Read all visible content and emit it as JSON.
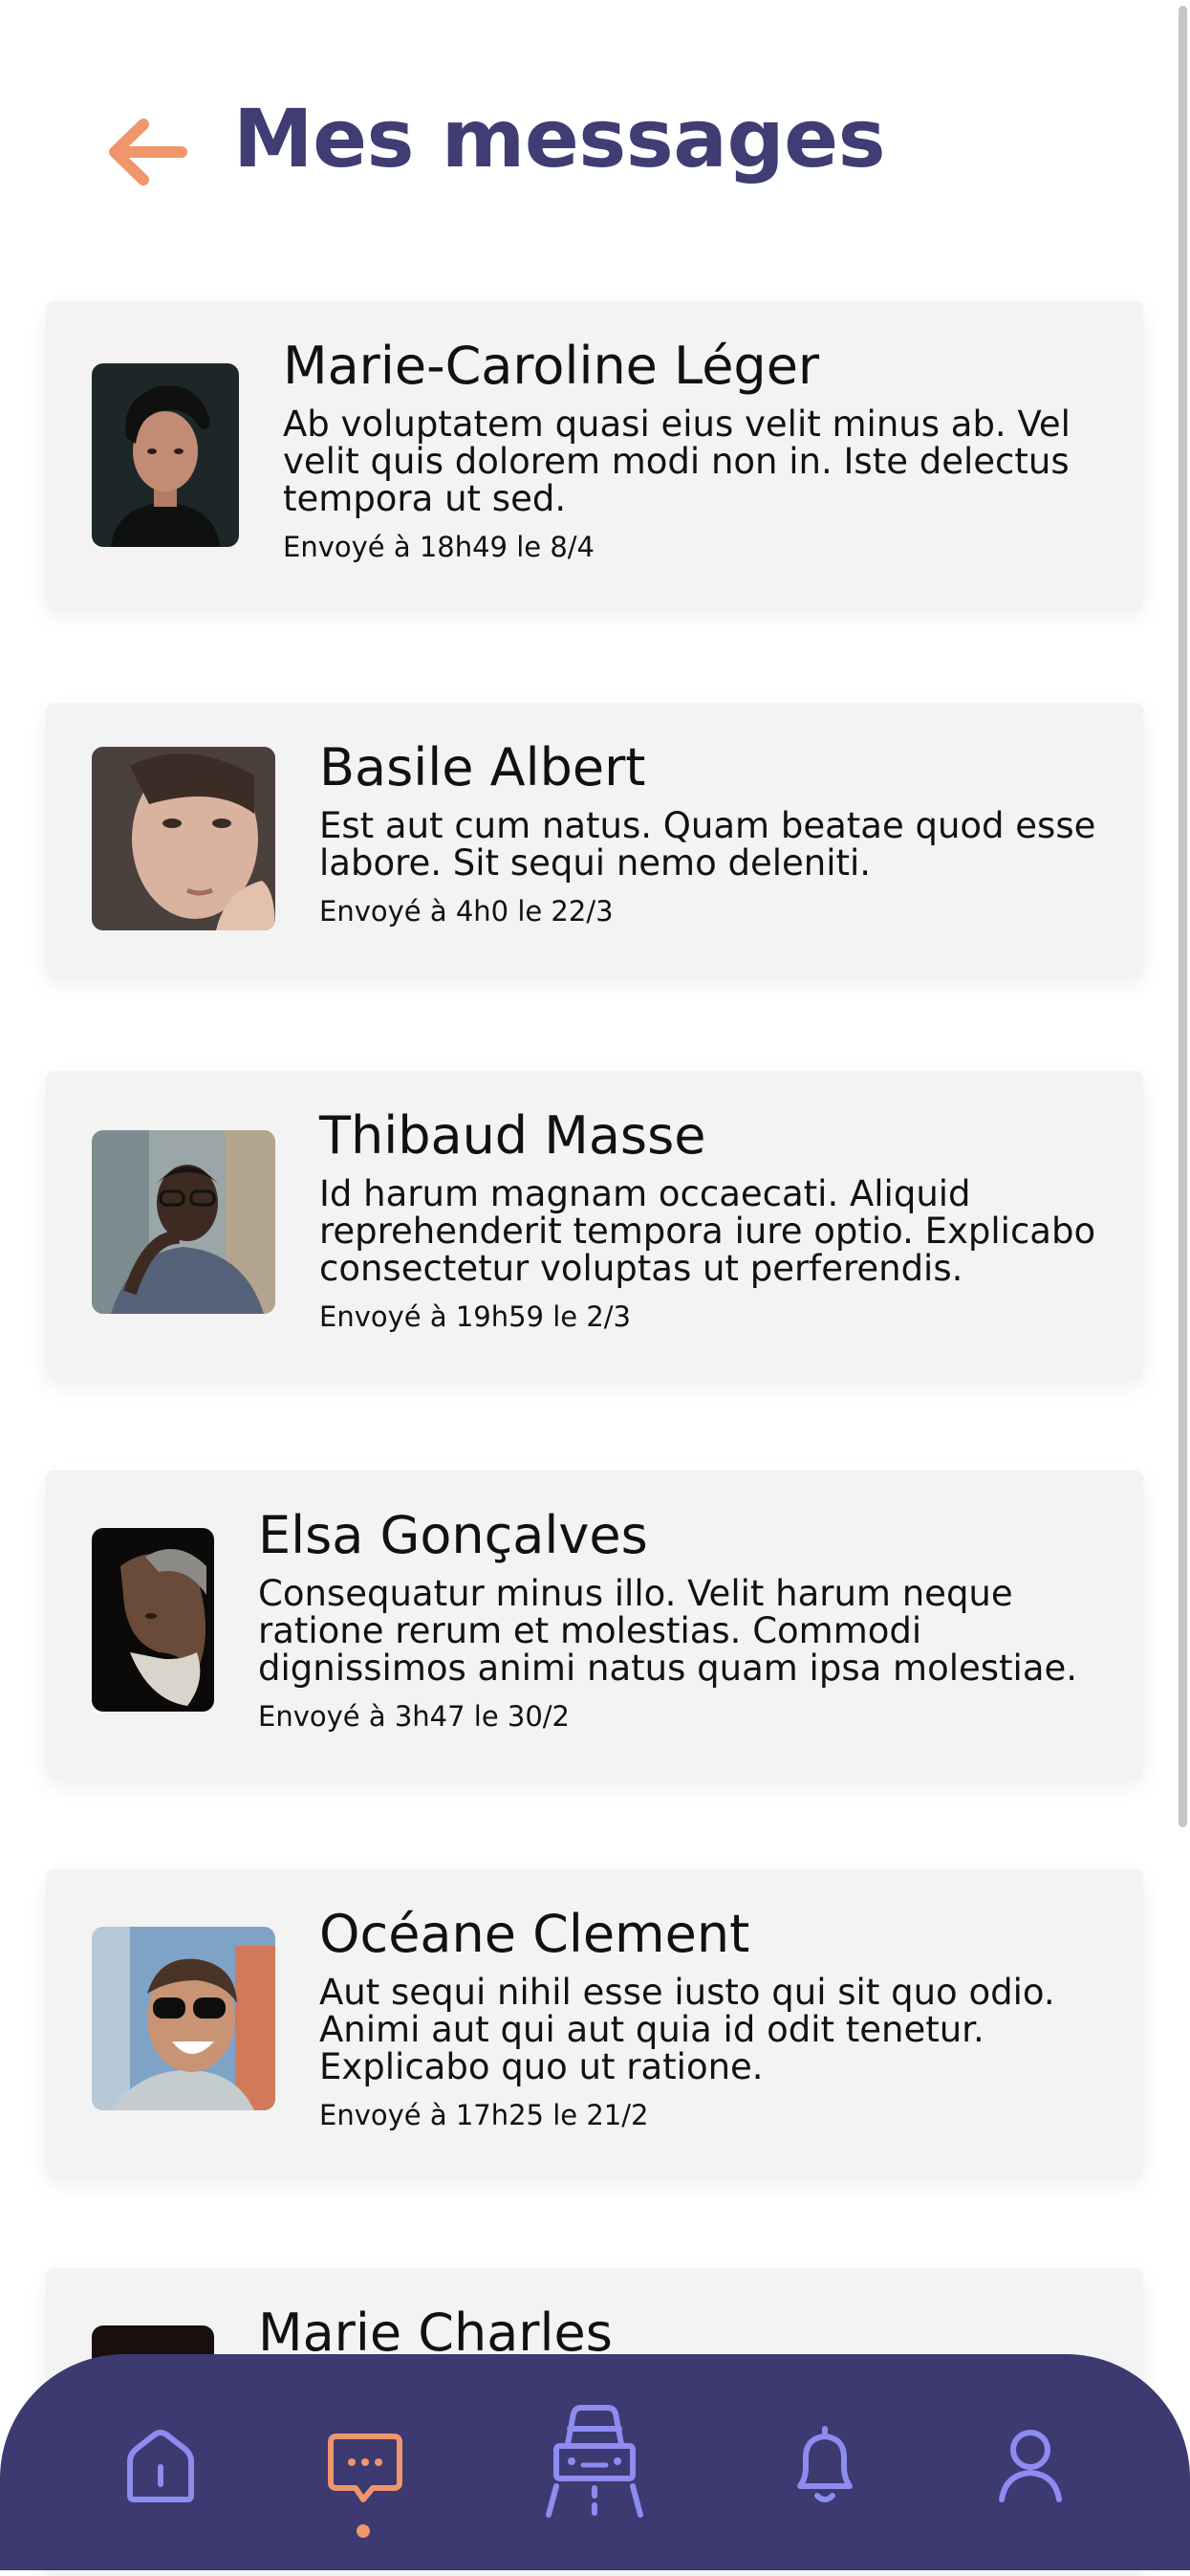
{
  "header": {
    "title": "Mes messages",
    "back_icon": "arrow-left-icon"
  },
  "colors": {
    "accent": "#f0966c",
    "primary": "#3f3d73",
    "nav_background": "#3c3a70",
    "nav_icon": "#8e8cf0",
    "card_background": "#f3f3f3"
  },
  "messages": [
    {
      "name": "Marie-Caroline Léger",
      "text": "Ab voluptatem quasi eius velit minus ab. Vel velit quis dolorem modi non in. Iste delectus tempora ut sed.",
      "time": "Envoyé à 18h49 le 8/4"
    },
    {
      "name": "Basile Albert",
      "text": "Est aut cum natus. Quam beatae quod esse labore. Sit sequi nemo deleniti.",
      "time": "Envoyé à 4h0 le 22/3"
    },
    {
      "name": "Thibaud Masse",
      "text": "Id harum magnam occaecati. Aliquid reprehenderit tempora iure optio. Explicabo consectetur voluptas ut perferendis.",
      "time": "Envoyé à 19h59 le 2/3"
    },
    {
      "name": "Elsa Gonçalves",
      "text": "Consequatur minus illo. Velit harum neque ratione rerum et molestias. Commodi dignissimos animi natus quam ipsa molestiae.",
      "time": "Envoyé à 3h47 le 30/2"
    },
    {
      "name": "Océane Clement",
      "text": "Aut sequi nihil esse iusto qui sit quo odio. Animi aut qui aut quia id odit tenetur. Explicabo quo ut ratione.",
      "time": "Envoyé à 17h25 le 21/2"
    },
    {
      "name": "Marie Charles"
    }
  ],
  "bottom_nav": {
    "items": [
      {
        "icon": "home-icon"
      },
      {
        "icon": "chat-bubble-icon",
        "active": true
      },
      {
        "icon": "car-road-icon"
      },
      {
        "icon": "bell-icon"
      },
      {
        "icon": "user-icon"
      }
    ]
  }
}
